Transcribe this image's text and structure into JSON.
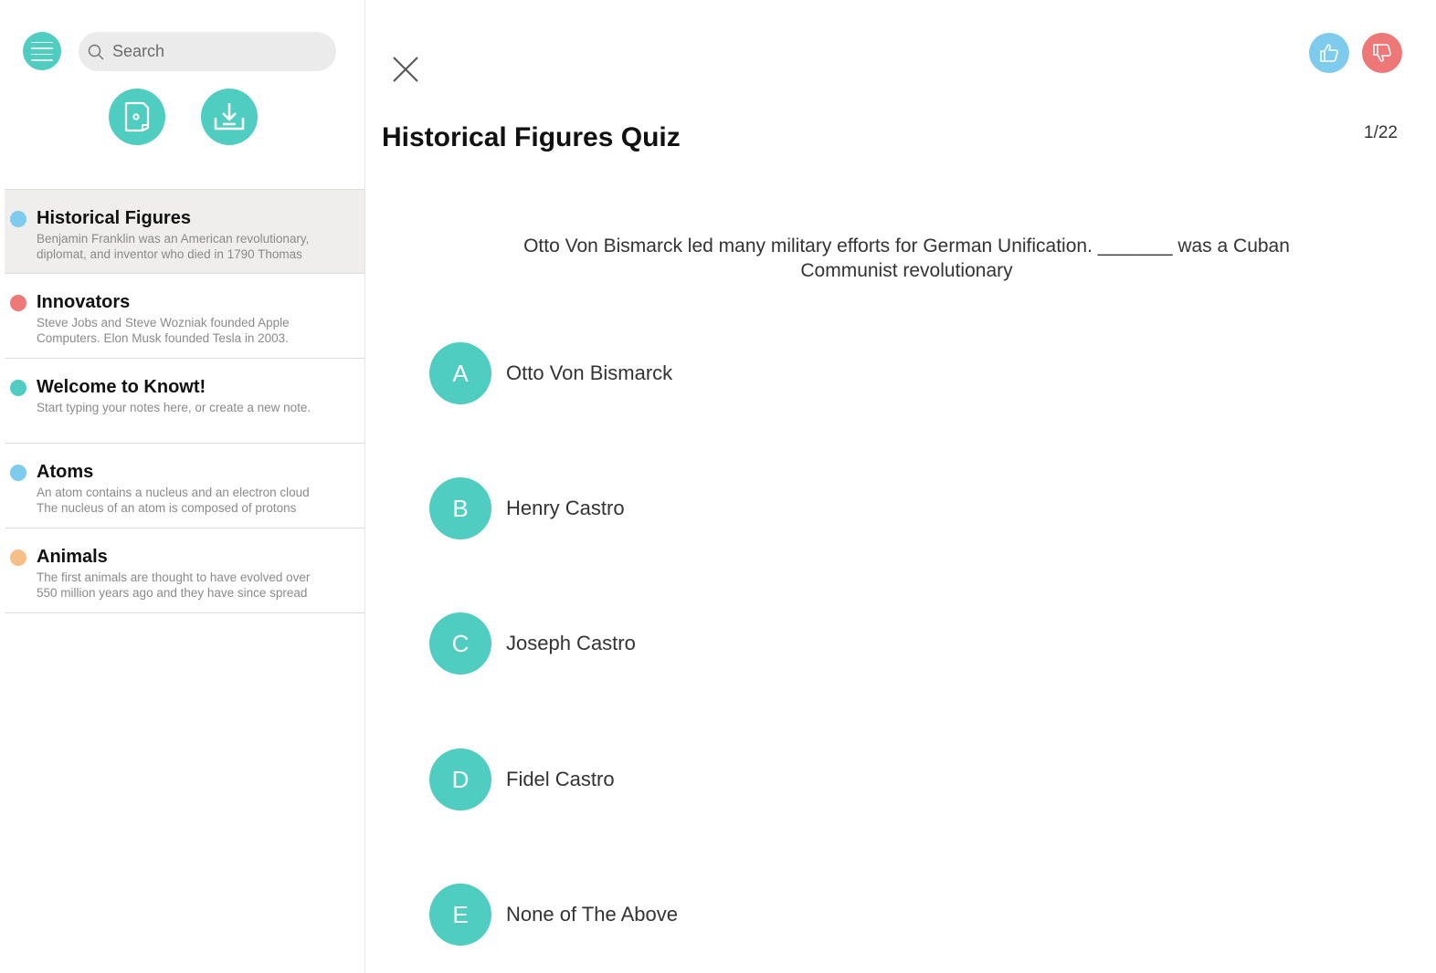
{
  "sidebar": {
    "search": {
      "placeholder": "Search"
    },
    "notes": [
      {
        "title": "Historical Figures",
        "preview": "Benjamin Franklin was an American revolutionary, diplomat, and inventor who died in 1790 Thomas",
        "color": "#7ecbee",
        "active": true
      },
      {
        "title": "Innovators",
        "preview": "Steve Jobs and Steve Wozniak founded Apple Computers. Elon Musk founded Tesla in 2003.",
        "color": "#ee7777",
        "active": false
      },
      {
        "title": "Welcome to Knowt!",
        "preview": "Start typing your notes here, or create a new note.",
        "color": "#4ecdc0",
        "active": false
      },
      {
        "title": "Atoms",
        "preview": "An atom contains a nucleus and an electron cloud The nucleus of an atom is composed of protons",
        "color": "#7ecbee",
        "active": false
      },
      {
        "title": "Animals",
        "preview": "The first animals are thought to have evolved over 550 million years ago and they have since spread",
        "color": "#f7bf88",
        "active": false
      }
    ]
  },
  "quiz": {
    "title": "Historical Figures Quiz",
    "progress": "1/22",
    "question": "Otto Von Bismarck led many military efforts for German Unification. _______ was a Cuban Communist revolutionary",
    "options": [
      {
        "letter": "A",
        "label": "Otto Von Bismarck"
      },
      {
        "letter": "B",
        "label": "Henry Castro"
      },
      {
        "letter": "C",
        "label": "Joseph Castro"
      },
      {
        "letter": "D",
        "label": "Fidel Castro"
      },
      {
        "letter": "E",
        "label": "None of The Above"
      }
    ]
  },
  "icons": {
    "menu": "hamburger-menu-icon",
    "search": "search-icon",
    "new_note": "new-document-icon",
    "download": "download-icon",
    "close": "close-icon",
    "thumbs_up": "thumbs-up-icon",
    "thumbs_down": "thumbs-down-icon"
  },
  "colors": {
    "accent": "#4ecdc0",
    "like": "#7ecbee",
    "dislike": "#ee7777"
  }
}
